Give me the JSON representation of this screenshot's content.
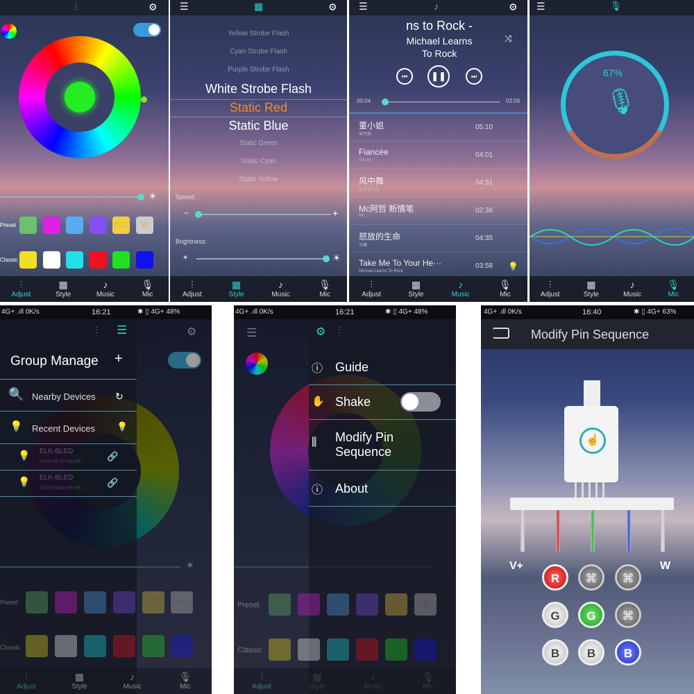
{
  "adjust_screen": {
    "tabs": [
      {
        "label": "Adjust",
        "icon": "sliders-icon"
      },
      {
        "label": "Style",
        "icon": "grid-icon"
      },
      {
        "label": "Music",
        "icon": "music-note-icon"
      },
      {
        "label": "Mic",
        "icon": "microphone-icon"
      }
    ],
    "preset_label": "Preset",
    "classic_label": "Classic",
    "preset_colors": [
      "#6cc070",
      "#e020e0",
      "#5aaaf0",
      "#8050f0",
      "#f0d040",
      "#cccccc"
    ],
    "preset_text": [
      "",
      "",
      "",
      "",
      "CCT",
      "W"
    ],
    "classic_colors": [
      "#f0e020",
      "#ffffff",
      "#20e0e8",
      "#f01020",
      "#20e020",
      "#1010f0"
    ],
    "accent": "#2bd4c8",
    "toggle_on": true
  },
  "style_screen": {
    "items": [
      "Yellow Strobe Flash",
      "Cyan Strobe Flash",
      "Purple Strobe Flash",
      "White Strobe Flash",
      "Static Red",
      "Static Blue",
      "Static Green",
      "Static Cyan",
      "Static Yellow"
    ],
    "selected": "Static Red",
    "speed_label": "Speed:",
    "brightness_label": "Brightness:",
    "minus": "−",
    "plus": "+"
  },
  "music_screen": {
    "title_lines": [
      "ns to Rock -",
      "Michael Learns",
      "To Rock"
    ],
    "elapsed": "00:04",
    "total": "03:58",
    "progress": 0.02,
    "songs": [
      {
        "title": "董小姐",
        "artist": "宋冬野",
        "duration": "05:10"
      },
      {
        "title": "Fiancée",
        "artist": "Sur-jor",
        "duration": "04:01"
      },
      {
        "title": "风中舞",
        "artist": "蓝冰雪乐队",
        "duration": "04:31"
      },
      {
        "title": "Mc阿哲 断情笔",
        "artist": "Mc",
        "duration": "02:38"
      },
      {
        "title": "怒放的生命",
        "artist": "汪峰",
        "duration": "04:35"
      },
      {
        "title": "Take Me To Your He···",
        "artist": "Michael Learns To Rock",
        "duration": "03:58"
      }
    ]
  },
  "mic_screen": {
    "level_text": "67%",
    "level": 0.67
  },
  "group_screen": {
    "status": {
      "left": "4G+ .ıll 0K/s",
      "time": "16:21",
      "right": "✱ ▯ 4G+ 48%"
    },
    "title": "Group Manage",
    "add": "+",
    "nearby": "Nearby Devices",
    "recent": "Recent Devices",
    "devices": [
      {
        "name": "ELK-BLED",
        "mac": "20:00:0C:57:6E:BE"
      },
      {
        "name": "ELK-BLED",
        "mac": "30:00:00:6E:6F:BE"
      }
    ],
    "preset_label": "Preset",
    "classic_label": "Classic",
    "cct": "CCT",
    "w": "W"
  },
  "menu_screen": {
    "status": {
      "left": "4G+ .ıll 0K/s",
      "time": "16:21",
      "right": "✱ ▯ 4G+ 48%"
    },
    "items": [
      {
        "label": "Guide",
        "icon": "help-icon"
      },
      {
        "label": "Shake",
        "icon": "shake-icon"
      },
      {
        "label": "Modify Pin Sequence",
        "icon": "pin-icon"
      },
      {
        "label": "About",
        "icon": "info-icon"
      }
    ],
    "shake_on": false,
    "preset_label": "Preset",
    "classic_label": "Classic",
    "cct": "CCT",
    "w": "W"
  },
  "pin_screen": {
    "status": {
      "left": "4G+ .ıll 0K/s",
      "time": "16:40",
      "right": "✱ ▯ 4G+ 63%"
    },
    "title": "Modify Pin Sequence",
    "vplus": "V+",
    "w": "W",
    "buttons": [
      [
        "R",
        "",
        ""
      ],
      [
        "G",
        "G",
        ""
      ],
      [
        "B",
        "B",
        "B"
      ]
    ],
    "pin_colors": [
      "#dddddd",
      "#e03030",
      "#30c040",
      "#3050e0",
      "#dddddd"
    ]
  }
}
